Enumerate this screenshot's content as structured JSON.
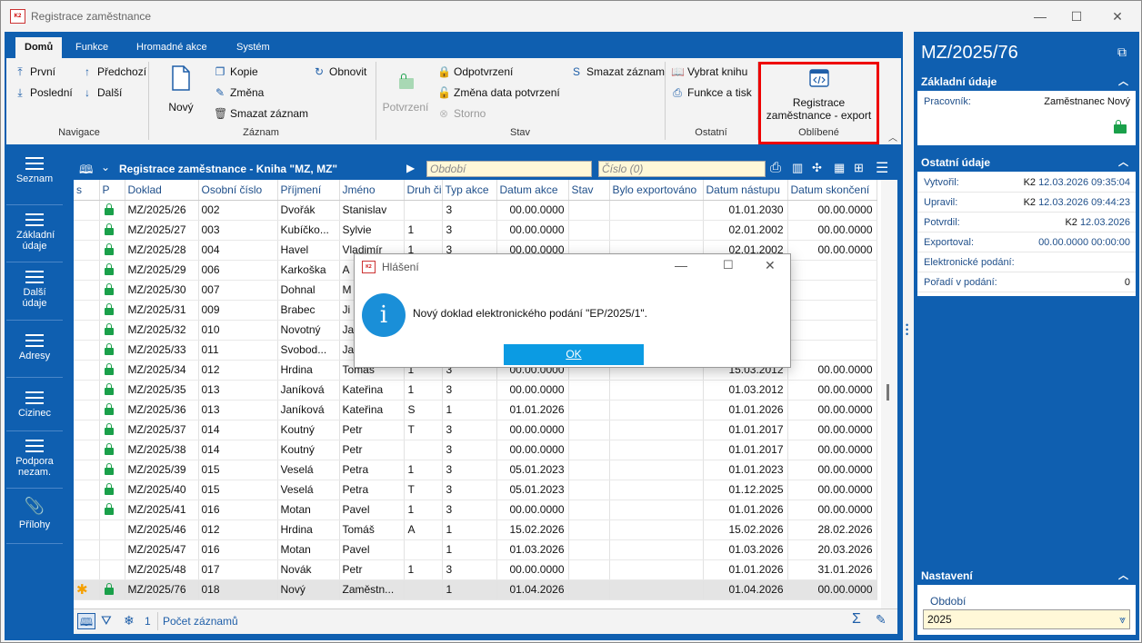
{
  "window": {
    "title": "Registrace zaměstnance",
    "logo": "K2",
    "minimize": "—",
    "maximize": "☐",
    "close": "✕"
  },
  "ribbon": {
    "tabs": [
      "Domů",
      "Funkce",
      "Hromadné akce",
      "Systém"
    ],
    "nav": {
      "first": "První",
      "last": "Poslední",
      "prev": "Předchozí",
      "next": "Další",
      "label": "Navigace"
    },
    "record": {
      "new": "Nový",
      "copy": "Kopie",
      "change": "Změna",
      "delete": "Smazat záznam",
      "refresh": "Obnovit",
      "label": "Záznam"
    },
    "state": {
      "confirm": "Potvrzení",
      "unconfirm": "Odpotvrzení",
      "change_date": "Změna data potvrzení",
      "storno": "Storno",
      "delete_rec": "Smazat záznam",
      "label": "Stav"
    },
    "other": {
      "pick_book": "Vybrat knihu",
      "functions_print": "Funkce a tisk",
      "label": "Ostatní"
    },
    "favorites": {
      "item_line1": "Registrace",
      "item_line2": "zaměstnance - export",
      "label": "Oblíbené"
    }
  },
  "leftnav": [
    {
      "label": "Seznam"
    },
    {
      "label": "Základní údaje"
    },
    {
      "label": "Další údaje"
    },
    {
      "label": "Adresy"
    },
    {
      "label": "Cizinec"
    },
    {
      "label": "Podpora nezam."
    },
    {
      "label": "Přílohy"
    }
  ],
  "grid": {
    "title": "Registrace zaměstnance - Kniha \"MZ, MZ\"",
    "obdobi_placeholder": "Období",
    "cislo_placeholder": "Číslo (0)",
    "columns": [
      "s",
      "P",
      "Doklad",
      "Osobní číslo",
      "Příjmení",
      "Jméno",
      "Druh či",
      "Typ akce",
      "Datum akce",
      "Stav",
      "Bylo exportováno",
      "Datum nástupu",
      "Datum skončení"
    ],
    "rows": [
      {
        "s": "",
        "p": true,
        "doklad": "MZ/2025/26",
        "os": "002",
        "prijmeni": "Dvořák",
        "jmeno": "Stanislav",
        "druh": "",
        "typ": "3",
        "datum": "00.00.0000",
        "stav": "",
        "exp": "",
        "nastup": "01.01.2030",
        "skonc": "00.00.0000"
      },
      {
        "s": "",
        "p": true,
        "doklad": "MZ/2025/27",
        "os": "003",
        "prijmeni": "Kubíčko...",
        "jmeno": "Sylvie",
        "druh": "1",
        "typ": "3",
        "datum": "00.00.0000",
        "stav": "",
        "exp": "",
        "nastup": "02.01.2002",
        "skonc": "00.00.0000"
      },
      {
        "s": "",
        "p": true,
        "doklad": "MZ/2025/28",
        "os": "004",
        "prijmeni": "Havel",
        "jmeno": "Vladimír",
        "druh": "1",
        "typ": "3",
        "datum": "00.00.0000",
        "stav": "",
        "exp": "",
        "nastup": "02.01.2002",
        "skonc": "00.00.0000"
      },
      {
        "s": "",
        "p": true,
        "doklad": "MZ/2025/29",
        "os": "006",
        "prijmeni": "Karkoška",
        "jmeno": "A",
        "druh": "",
        "typ": "",
        "datum": "",
        "stav": "",
        "exp": "",
        "nastup": "",
        "skonc": ""
      },
      {
        "s": "",
        "p": true,
        "doklad": "MZ/2025/30",
        "os": "007",
        "prijmeni": "Dohnal",
        "jmeno": "M",
        "druh": "",
        "typ": "",
        "datum": "",
        "stav": "",
        "exp": "",
        "nastup": "",
        "skonc": ""
      },
      {
        "s": "",
        "p": true,
        "doklad": "MZ/2025/31",
        "os": "009",
        "prijmeni": "Brabec",
        "jmeno": "Ji",
        "druh": "",
        "typ": "",
        "datum": "",
        "stav": "",
        "exp": "",
        "nastup": "",
        "skonc": ""
      },
      {
        "s": "",
        "p": true,
        "doklad": "MZ/2025/32",
        "os": "010",
        "prijmeni": "Novotný",
        "jmeno": "Ja",
        "druh": "",
        "typ": "",
        "datum": "",
        "stav": "",
        "exp": "",
        "nastup": "",
        "skonc": ""
      },
      {
        "s": "",
        "p": true,
        "doklad": "MZ/2025/33",
        "os": "011",
        "prijmeni": "Svobod...",
        "jmeno": "Ja",
        "druh": "",
        "typ": "",
        "datum": "",
        "stav": "",
        "exp": "",
        "nastup": "",
        "skonc": ""
      },
      {
        "s": "",
        "p": true,
        "doklad": "MZ/2025/34",
        "os": "012",
        "prijmeni": "Hrdina",
        "jmeno": "Tomáš",
        "druh": "1",
        "typ": "3",
        "datum": "00.00.0000",
        "stav": "",
        "exp": "",
        "nastup": "15.03.2012",
        "skonc": "00.00.0000"
      },
      {
        "s": "",
        "p": true,
        "doklad": "MZ/2025/35",
        "os": "013",
        "prijmeni": "Janíková",
        "jmeno": "Kateřina",
        "druh": "1",
        "typ": "3",
        "datum": "00.00.0000",
        "stav": "",
        "exp": "",
        "nastup": "01.03.2012",
        "skonc": "00.00.0000"
      },
      {
        "s": "",
        "p": true,
        "doklad": "MZ/2025/36",
        "os": "013",
        "prijmeni": "Janíková",
        "jmeno": "Kateřina",
        "druh": "S",
        "typ": "1",
        "datum": "01.01.2026",
        "stav": "",
        "exp": "",
        "nastup": "01.01.2026",
        "skonc": "00.00.0000"
      },
      {
        "s": "",
        "p": true,
        "doklad": "MZ/2025/37",
        "os": "014",
        "prijmeni": "Koutný",
        "jmeno": "Petr",
        "druh": "T",
        "typ": "3",
        "datum": "00.00.0000",
        "stav": "",
        "exp": "",
        "nastup": "01.01.2017",
        "skonc": "00.00.0000"
      },
      {
        "s": "",
        "p": true,
        "doklad": "MZ/2025/38",
        "os": "014",
        "prijmeni": "Koutný",
        "jmeno": "Petr",
        "druh": "",
        "typ": "3",
        "datum": "00.00.0000",
        "stav": "",
        "exp": "",
        "nastup": "01.01.2017",
        "skonc": "00.00.0000"
      },
      {
        "s": "",
        "p": true,
        "doklad": "MZ/2025/39",
        "os": "015",
        "prijmeni": "Veselá",
        "jmeno": "Petra",
        "druh": "1",
        "typ": "3",
        "datum": "05.01.2023",
        "stav": "",
        "exp": "",
        "nastup": "01.01.2023",
        "skonc": "00.00.0000"
      },
      {
        "s": "",
        "p": true,
        "doklad": "MZ/2025/40",
        "os": "015",
        "prijmeni": "Veselá",
        "jmeno": "Petra",
        "druh": "T",
        "typ": "3",
        "datum": "05.01.2023",
        "stav": "",
        "exp": "",
        "nastup": "01.12.2025",
        "skonc": "00.00.0000"
      },
      {
        "s": "",
        "p": true,
        "doklad": "MZ/2025/41",
        "os": "016",
        "prijmeni": "Motan",
        "jmeno": "Pavel",
        "druh": "1",
        "typ": "3",
        "datum": "00.00.0000",
        "stav": "",
        "exp": "",
        "nastup": "01.01.2026",
        "skonc": "00.00.0000"
      },
      {
        "s": "",
        "p": false,
        "doklad": "MZ/2025/46",
        "os": "012",
        "prijmeni": "Hrdina",
        "jmeno": "Tomáš",
        "druh": "A",
        "typ": "1",
        "datum": "15.02.2026",
        "stav": "",
        "exp": "",
        "nastup": "15.02.2026",
        "skonc": "28.02.2026"
      },
      {
        "s": "",
        "p": false,
        "doklad": "MZ/2025/47",
        "os": "016",
        "prijmeni": "Motan",
        "jmeno": "Pavel",
        "druh": "",
        "typ": "1",
        "datum": "01.03.2026",
        "stav": "",
        "exp": "",
        "nastup": "01.03.2026",
        "skonc": "20.03.2026"
      },
      {
        "s": "",
        "p": false,
        "doklad": "MZ/2025/48",
        "os": "017",
        "prijmeni": "Novák",
        "jmeno": "Petr",
        "druh": "1",
        "typ": "3",
        "datum": "00.00.0000",
        "stav": "",
        "exp": "",
        "nastup": "01.01.2026",
        "skonc": "31.01.2026"
      },
      {
        "s": "✱",
        "p": true,
        "doklad": "MZ/2025/76",
        "os": "018",
        "prijmeni": "Nový",
        "jmeno": "Zaměstn...",
        "druh": "",
        "typ": "1",
        "datum": "01.04.2026",
        "stav": "",
        "exp": "",
        "nastup": "01.04.2026",
        "skonc": "00.00.0000"
      }
    ],
    "footer": {
      "filter_count": "1",
      "record_count_label": "Počet záznamů"
    }
  },
  "right_panel": {
    "title": "MZ/2025/76",
    "basic": {
      "header": "Základní údaje",
      "worker_label": "Pracovník:",
      "worker_value": "Zaměstnanec Nový"
    },
    "other": {
      "header": "Ostatní údaje",
      "rows": [
        {
          "label": "Vytvořil:",
          "prefix": "K2",
          "value": "12.03.2026 09:35:04"
        },
        {
          "label": "Upravil:",
          "prefix": "K2",
          "value": "12.03.2026 09:44:23"
        },
        {
          "label": "Potvrdil:",
          "prefix": "K2",
          "value": "12.03.2026"
        },
        {
          "label": "Exportoval:",
          "prefix": "",
          "value": "00.00.0000 00:00:00"
        },
        {
          "label": "Elektronické podání:",
          "prefix": "",
          "value": ""
        },
        {
          "label": "Pořadí v podání:",
          "prefix": "",
          "value": "0"
        }
      ]
    },
    "settings": {
      "header": "Nastavení",
      "obdobi_label": "Období",
      "obdobi_value": "2025"
    }
  },
  "dialog": {
    "title": "Hlášení",
    "message": "Nový doklad elektronického podání \"EP/2025/1\".",
    "ok": "OK"
  },
  "colors": {
    "accent": "#0f5fb0",
    "ok_button": "#0b9be3",
    "lock": "#1aa04a",
    "highlight": "#e00000"
  }
}
